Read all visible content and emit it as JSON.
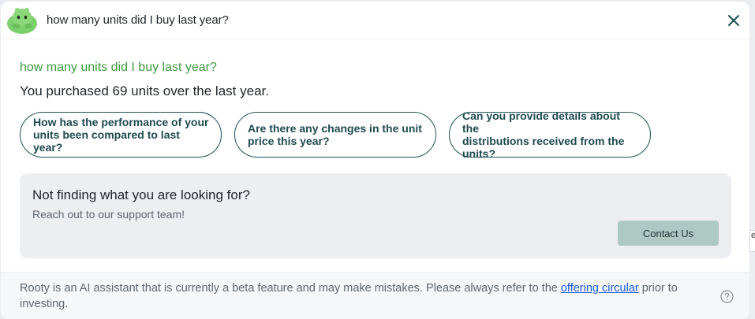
{
  "header": {
    "title": "how many units did I buy last year?",
    "close_icon": "close-x-icon",
    "avatar_icon": "green-blob-avatar-icon"
  },
  "conversation": {
    "question": "how many units did I buy last year?",
    "answer": "You purchased 69 units over the last year."
  },
  "suggestions": [
    {
      "line1": "How has the performance of your",
      "line2": "units been compared to last year?",
      "line3": ""
    },
    {
      "line1": "Are there any changes in the unit",
      "line2": "price this year?",
      "line3": ""
    },
    {
      "line1": "Can you provide details about the",
      "line2": "distributions received from the",
      "line3": "units?"
    }
  ],
  "support": {
    "title": "Not finding what you are looking for?",
    "subtitle": "Reach out to our support team!",
    "button_label": "Contact Us"
  },
  "footer": {
    "text_before_link": "Rooty is an AI assistant that is currently a beta feature and may make mistakes. Please always refer to the ",
    "link_text": "offering circular",
    "text_after_link": " prior to investing.",
    "help_icon": "question-circle-icon"
  },
  "edge_tab_text": "e",
  "colors": {
    "accent_green": "#3e9a3e",
    "chip_border": "#1d5156",
    "contact_button": "#aec8c4",
    "link": "#1a5bd6"
  }
}
